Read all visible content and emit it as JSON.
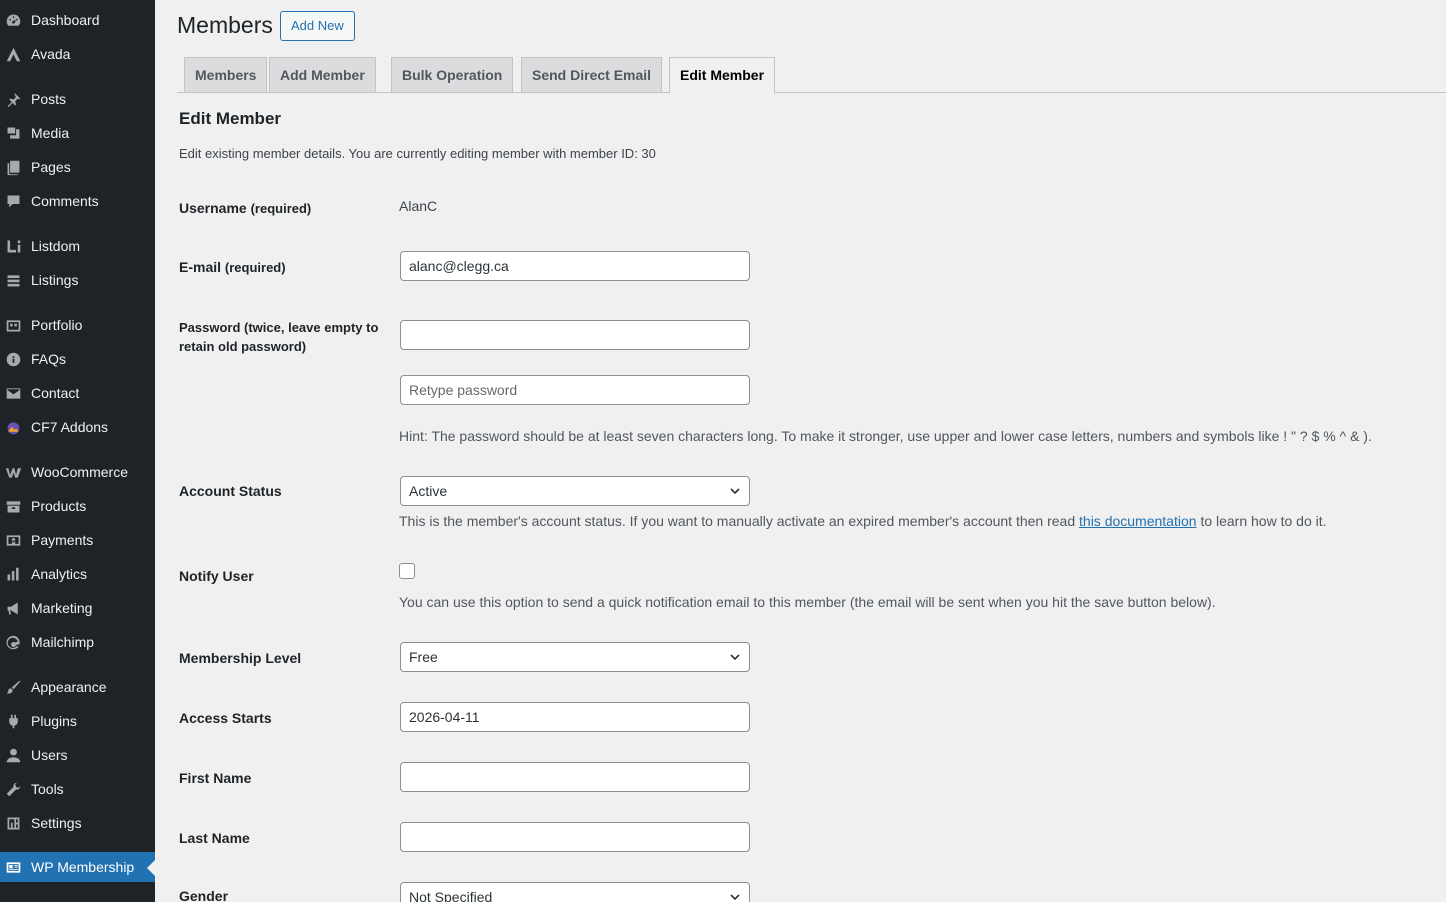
{
  "sidebar": {
    "items": [
      {
        "label": "Dashboard",
        "icon": "dashboard-icon"
      },
      {
        "label": "Avada",
        "icon": "avada-icon"
      },
      {
        "label": "Posts",
        "icon": "pin-icon"
      },
      {
        "label": "Media",
        "icon": "media-icon"
      },
      {
        "label": "Pages",
        "icon": "pages-icon"
      },
      {
        "label": "Comments",
        "icon": "comment-icon"
      },
      {
        "label": "Listdom",
        "icon": "listdom-icon"
      },
      {
        "label": "Listings",
        "icon": "listings-icon"
      },
      {
        "label": "Portfolio",
        "icon": "portfolio-icon"
      },
      {
        "label": "FAQs",
        "icon": "info-icon"
      },
      {
        "label": "Contact",
        "icon": "mail-icon"
      },
      {
        "label": "CF7 Addons",
        "icon": "cf7-addons-icon"
      },
      {
        "label": "WooCommerce",
        "icon": "woocommerce-icon"
      },
      {
        "label": "Products",
        "icon": "archive-icon"
      },
      {
        "label": "Payments",
        "icon": "payments-icon"
      },
      {
        "label": "Analytics",
        "icon": "chart-bar-icon"
      },
      {
        "label": "Marketing",
        "icon": "megaphone-icon"
      },
      {
        "label": "Mailchimp",
        "icon": "mailchimp-icon"
      },
      {
        "label": "Appearance",
        "icon": "paintbrush-icon"
      },
      {
        "label": "Plugins",
        "icon": "plugin-icon"
      },
      {
        "label": "Users",
        "icon": "user-icon"
      },
      {
        "label": "Tools",
        "icon": "wrench-icon"
      },
      {
        "label": "Settings",
        "icon": "settings-icon"
      },
      {
        "label": "WP Membership",
        "icon": "id-card-icon"
      }
    ],
    "current": "WP Membership"
  },
  "header": {
    "title": "Members",
    "add_new_label": "Add New"
  },
  "tabs": [
    {
      "label": "Members"
    },
    {
      "label": "Add Member"
    },
    {
      "label": "Bulk Operation"
    },
    {
      "label": "Send Direct Email"
    },
    {
      "label": "Edit Member",
      "active": true
    }
  ],
  "form": {
    "title": "Edit Member",
    "description": "Edit existing member details. You are currently editing member with member ID: 30",
    "username_label": "Username",
    "required_suffix": "(required)",
    "username_value": "AlanC",
    "email_label": "E-mail",
    "email_value": "alanc@clegg.ca",
    "password_label": "Password (twice, leave empty to retain old password)",
    "password_value": "",
    "retype_placeholder": "Retype password",
    "password_hint": "Hint: The password should be at least seven characters long. To make it stronger, use upper and lower case letters, numbers and symbols like ! \" ? $ % ^ & ).",
    "account_status_label": "Account Status",
    "account_status_value": "Active",
    "account_status_hint_before": "This is the member's account status. If you want to manually activate an expired member's account then read",
    "account_status_hint_link": "this documentation",
    "account_status_hint_after": "to learn how to do it.",
    "notify_label": "Notify User",
    "notify_checked": false,
    "notify_hint": "You can use this option to send a quick notification email to this member (the email will be sent when you hit the save button below).",
    "membership_level_label": "Membership Level",
    "membership_level_value": "Free",
    "access_starts_label": "Access Starts",
    "access_starts_value": "2026-04-11",
    "first_name_label": "First Name",
    "first_name_value": "",
    "last_name_label": "Last Name",
    "last_name_value": "",
    "gender_label": "Gender",
    "gender_value": "Not Specified"
  },
  "colors": {
    "sidebar_bg": "#1d2327",
    "accent": "#2271b1",
    "page_bg": "#f0f0f1"
  }
}
